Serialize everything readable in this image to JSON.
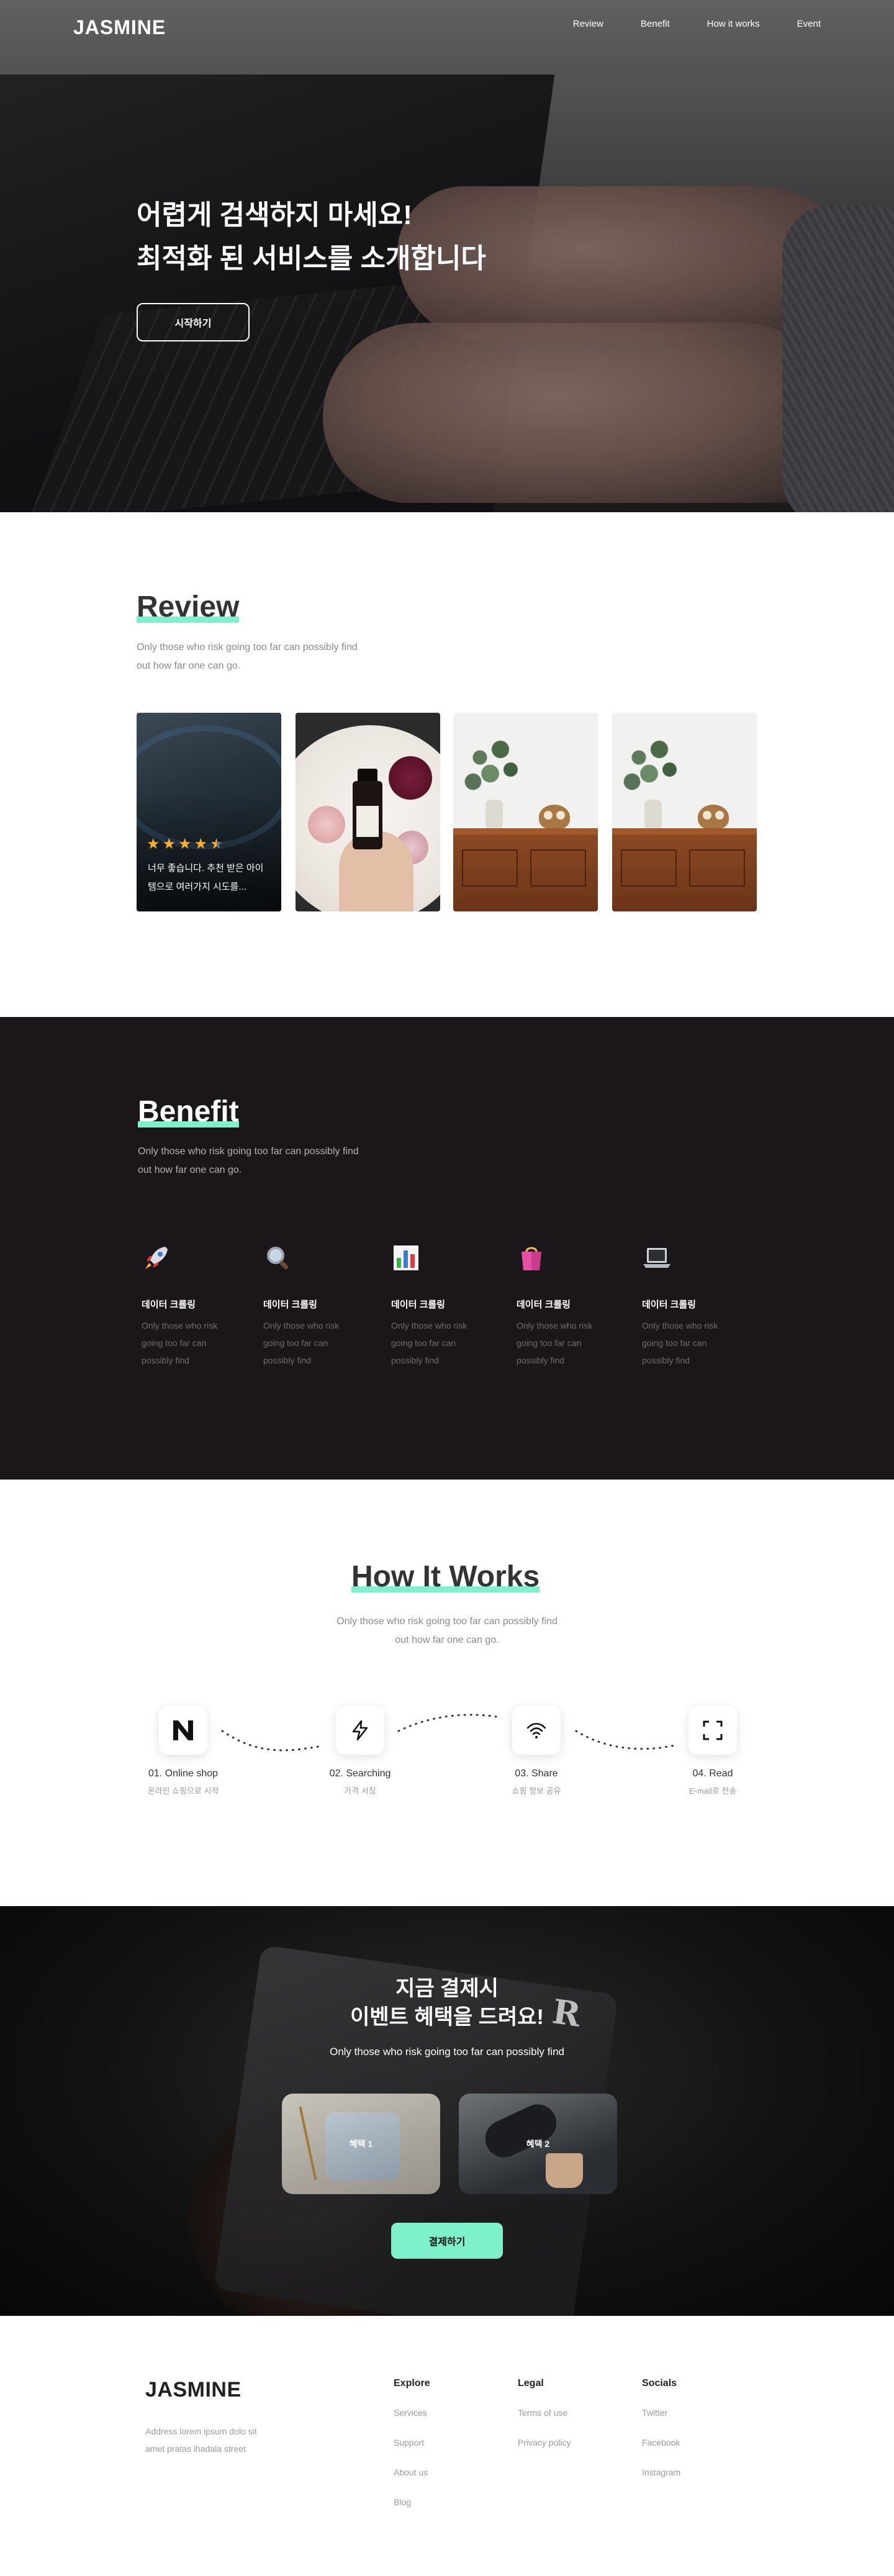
{
  "nav": {
    "logo": "JASMINE",
    "links": [
      "Review",
      "Benefit",
      "How it works",
      "Event"
    ]
  },
  "hero": {
    "title_line1": "어렵게 검색하지 마세요!",
    "title_line2": "최적화 된 서비스를 소개합니다",
    "cta": "시작하기"
  },
  "review": {
    "title": "Review",
    "subtitle_line1": "Only those who risk going too far can possibly find",
    "subtitle_line2": "out how far one can go.",
    "rating": 4.5,
    "card_text": "너무 좋습니다. 추천 받은 아이템으로 여러가지 시도를..."
  },
  "benefit": {
    "title": "Benefit",
    "subtitle_line1": "Only those who risk going too far can possibly find",
    "subtitle_line2": "out how far one can go.",
    "items": [
      {
        "icon": "rocket-icon",
        "name": "데이터 크롤링",
        "desc": "Only those who risk going too far can possibly find"
      },
      {
        "icon": "magnifier-icon",
        "name": "데이터 크롤링",
        "desc": "Only those who risk going too far can possibly find"
      },
      {
        "icon": "bar-chart-icon",
        "name": "데이터 크롤링",
        "desc": "Only those who risk going too far can possibly find"
      },
      {
        "icon": "shopping-bag-icon",
        "name": "데이터 크롤링",
        "desc": "Only those who risk going too far can possibly find"
      },
      {
        "icon": "laptop-icon",
        "name": "데이터 크롤링",
        "desc": "Only those who risk going too far can possibly find"
      }
    ]
  },
  "how": {
    "title": "How It Works",
    "subtitle_line1": "Only those who risk going too far can possibly find",
    "subtitle_line2": "out how far one can go.",
    "steps": [
      {
        "icon": "n-logo-icon",
        "name": "01. Online shop",
        "desc": "온라인 쇼핑으로 시작"
      },
      {
        "icon": "lightning-icon",
        "name": "02. Searching",
        "desc": "가격 서칭"
      },
      {
        "icon": "wifi-icon",
        "name": "03. Share",
        "desc": "쇼핑 정보 공유"
      },
      {
        "icon": "expand-icon",
        "name": "04. Read",
        "desc": "E-mail로 전송"
      }
    ]
  },
  "event": {
    "title_line1": "지금 결제시",
    "title_line2": "이벤트 혜택을 드려요!",
    "subtitle": "Only those who risk going too far can possibly find",
    "benefit1": "혜택 1",
    "benefit2": "혜택 2",
    "cta": "결제하기",
    "accent": "#7ef0cc"
  },
  "footer": {
    "logo": "JASMINE",
    "address_line1": "Address lorem ipsum dolo sit",
    "address_line2": "amet pratas lhadala street",
    "columns": [
      {
        "title": "Explore",
        "links": [
          "Services",
          "Support",
          "About us",
          "Blog"
        ]
      },
      {
        "title": "Legal",
        "links": [
          "Terms of use",
          "Privacy policy"
        ]
      },
      {
        "title": "Socials",
        "links": [
          "Twitter",
          "Facebook",
          "Instagram"
        ]
      }
    ]
  }
}
